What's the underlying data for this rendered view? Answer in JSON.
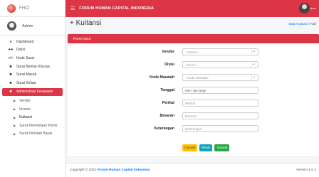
{
  "brand": {
    "name": "FHCI"
  },
  "user": {
    "name": "Admin"
  },
  "sidebar": {
    "items": [
      {
        "label": "Dashboard",
        "icon": "dashboard-icon"
      },
      {
        "label": "Divisi",
        "icon": "users-icon"
      },
      {
        "label": "Kode Surat",
        "icon": "code-icon"
      },
      {
        "label": "Surat Bentuk Khusus",
        "icon": "folder-icon"
      },
      {
        "label": "Surat Masuk",
        "icon": "folder-icon"
      },
      {
        "label": "Surat Keluar",
        "icon": "folder-icon"
      },
      {
        "label": "Administrasi Keuangan",
        "icon": "folder-icon"
      }
    ],
    "subitems": [
      {
        "label": "Vendor"
      },
      {
        "label": "Invoice"
      },
      {
        "label": "Kuitansi"
      },
      {
        "label": "Surat Permintaan Pemb"
      },
      {
        "label": "Surat Perintah Bayar"
      }
    ]
  },
  "topbar": {
    "title": "FORUM HUMAN CAPITAL INDONESIA",
    "user": "Admin"
  },
  "header": {
    "title": "Kuitansi",
    "breadcrumb_link": "Data Kuitansi",
    "breadcrumb_sep": "/",
    "breadcrumb_current": "Add"
  },
  "form": {
    "title": "Form Input",
    "fields": [
      {
        "label": "Vendor",
        "placeholder": "--Vendor--"
      },
      {
        "label": "Divisi",
        "placeholder": "--Divisi--"
      },
      {
        "label": "Kode Masalah",
        "placeholder": "--Kode Masalah--"
      },
      {
        "label": "Tanggal",
        "placeholder": "mm / dd / yyyy"
      },
      {
        "label": "Perihal",
        "placeholder": "Perihal"
      },
      {
        "label": "Besaran",
        "placeholder": "Besaran"
      },
      {
        "label": "Keterangan",
        "placeholder": "Keterangan"
      }
    ],
    "cancel_label": "Cancel",
    "reset_label": "Reset",
    "submit_label": "Submit"
  },
  "footer": {
    "copyright_prefix": "Copyright © 2021",
    "copyright_link": "Forum Human Capital Indonesia",
    "copyright_suffix": ".",
    "version": "Version 1.0.4"
  }
}
